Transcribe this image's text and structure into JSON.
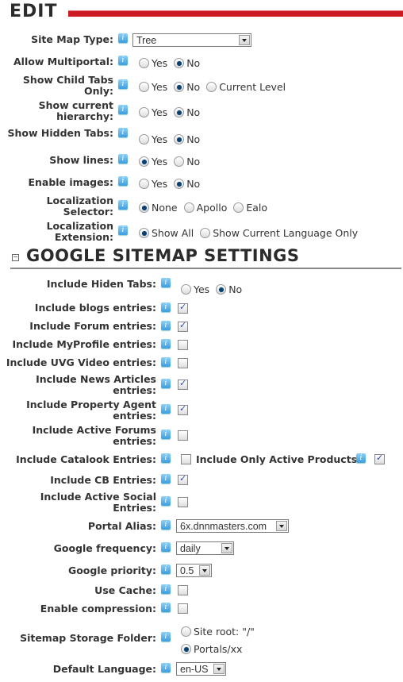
{
  "edit": {
    "title": "EDIT",
    "site_map_type": {
      "label": "Site Map Type:",
      "value": "Tree"
    },
    "allow_multiportal": {
      "label": "Allow Multiportal:",
      "options": [
        "Yes",
        "No"
      ],
      "selected": "No"
    },
    "show_child_tabs": {
      "label1": "Show Child Tabs",
      "label2": "Only:",
      "options": [
        "Yes",
        "No",
        "Current Level"
      ],
      "selected": "No"
    },
    "show_current_hierarchy": {
      "label1": "Show current",
      "label2": "hierarchy:",
      "options": [
        "Yes",
        "No"
      ],
      "selected": "No"
    },
    "show_hidden_tabs": {
      "label": "Show Hidden Tabs:",
      "options": [
        "Yes",
        "No"
      ],
      "selected": "No"
    },
    "show_lines": {
      "label": "Show lines:",
      "options": [
        "Yes",
        "No"
      ],
      "selected": "Yes"
    },
    "enable_images": {
      "label": "Enable images:",
      "options": [
        "Yes",
        "No"
      ],
      "selected": "No"
    },
    "localization_selector": {
      "label1": "Localization",
      "label2": "Selector:",
      "options": [
        "None",
        "Apollo",
        "Ealo"
      ],
      "selected": "None"
    },
    "localization_extension": {
      "label1": "Localization",
      "label2": "Extension:",
      "options": [
        "Show All",
        "Show Current Language Only"
      ],
      "selected": "Show All"
    }
  },
  "google": {
    "title": "GOOGLE SITEMAP SETTINGS",
    "collapse_symbol": "−",
    "include_hidden_tabs": {
      "label": "Include Hiden Tabs:",
      "options": [
        "Yes",
        "No"
      ],
      "selected": "No"
    },
    "checkboxes": [
      {
        "label1": "Include blogs entries:",
        "checked": true
      },
      {
        "label1": "Include Forum entries:",
        "checked": true
      },
      {
        "label1": "Include MyProfile entries:",
        "checked": false
      },
      {
        "label1": "Include UVG Video entries:",
        "checked": false
      },
      {
        "label1": "Include News Articles",
        "label2": "entries:",
        "checked": true
      },
      {
        "label1": "Include Property Agent",
        "label2": "entries:",
        "checked": true
      },
      {
        "label1": "Include Active Forums",
        "label2": "entries:",
        "checked": false
      }
    ],
    "catalook": {
      "label": "Include Catalook Entries:",
      "checked": false,
      "sub_label": "Include Only Active Products:",
      "sub_checked": true
    },
    "cb_entries": {
      "label": "Include CB Entries:",
      "checked": true
    },
    "active_social": {
      "label1": "Include Active Social",
      "label2": "Entries:",
      "checked": false
    },
    "portal_alias": {
      "label": "Portal Alias:",
      "value": "6x.dnnmasters.com"
    },
    "google_frequency": {
      "label": "Google frequency:",
      "value": "daily"
    },
    "google_priority": {
      "label": "Google priority:",
      "value": "0.5"
    },
    "use_cache": {
      "label": "Use Cache:",
      "checked": false
    },
    "enable_compression": {
      "label": "Enable compression:",
      "checked": false
    },
    "storage_folder": {
      "label": "Sitemap Storage Folder:",
      "options": [
        "Site root: \"/\"",
        "Portals/xx"
      ],
      "selected": "Portals/xx"
    },
    "default_language": {
      "label": "Default Language:",
      "value": "en-US"
    }
  }
}
